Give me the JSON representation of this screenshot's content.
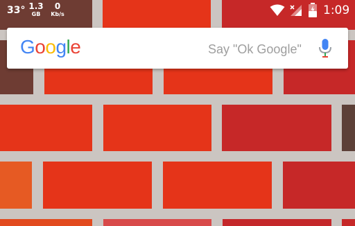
{
  "status_bar": {
    "temperature": "33°",
    "memory_value": "1.3",
    "memory_unit": "GB",
    "network_value": "0",
    "network_unit": "Kb/s",
    "time": "1:09",
    "icons": [
      "wifi-icon",
      "signal-icon",
      "battery-icon"
    ]
  },
  "search": {
    "logo_letters": [
      "G",
      "o",
      "o",
      "g",
      "l",
      "e"
    ],
    "logo_colors": [
      "#4285F4",
      "#EA4335",
      "#FBBC05",
      "#4285F4",
      "#34A853",
      "#EA4335"
    ],
    "hint": "Say \"Ok Google\"",
    "mic_icon": "mic-icon"
  },
  "colors": {
    "brick_red": "#e53419",
    "brick_crimson": "#c62828",
    "mortar": "#cbc5c1",
    "search_hint": "#9e9e9e"
  }
}
